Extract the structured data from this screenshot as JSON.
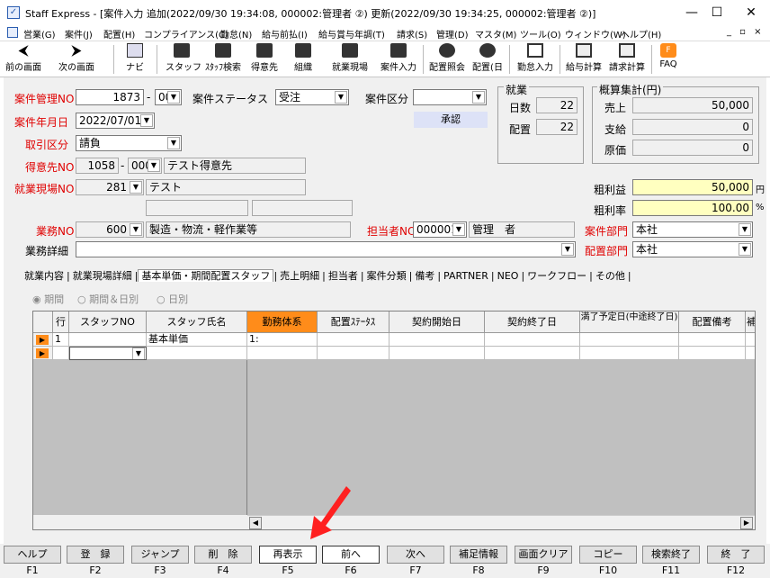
{
  "window": {
    "title": "Staff Express - [案件入力 追加(2022/09/30 19:34:08, 000002:管理者 ②) 更新(2022/09/30 19:34:25, 000002:管理者 ②)]",
    "min": "—",
    "max": "☐",
    "close": "✕"
  },
  "menu": {
    "items": [
      "営業(G)",
      "案件(J)",
      "配置(H)",
      "コンプライアンス(C)",
      "勤怠(N)",
      "給与前払(I)",
      "給与賞与年調(T)",
      "請求(S)",
      "管理(D)",
      "マスタ(M)",
      "ツール(O)",
      "ウィンドウ(W)",
      "ヘルプ(H)"
    ],
    "mdi": "_ ▫ ×"
  },
  "toolbar": {
    "items": [
      "前の画面",
      "次の画面",
      "ナビ",
      "スタッフ",
      "ｽﾀｯﾌ検索",
      "得意先",
      "組織",
      "就業現場",
      "案件入力",
      "配置照会",
      "配置(日",
      "勤怠入力",
      "給与計算",
      "請求計算",
      "FAQ"
    ]
  },
  "form": {
    "case_no_label": "案件管理NO",
    "case_no": "1873",
    "case_branch": "000",
    "status_label": "案件ステータス",
    "status": "受注",
    "category_label": "案件区分",
    "category": "",
    "approve_label": "承認",
    "date_label": "案件年月日",
    "date": "2022/07/01",
    "trade_label": "取引区分",
    "trade": "請負",
    "client_label": "得意先NO",
    "client_no": "1058",
    "client_branch": "000",
    "client_name": "テスト得意先",
    "site_label": "就業現場NO",
    "site_no": "281",
    "site_name": "テスト",
    "work_label": "業務NO",
    "work_no": "600",
    "work_name": "製造・物流・軽作業等",
    "staff_label": "担当者NO",
    "staff_no": "000001",
    "staff_name": "管理　者",
    "dept_label": "案件部門",
    "dept": "本社",
    "detail_label": "業務詳細",
    "detail": "",
    "placedept_label": "配置部門",
    "placedept": "本社",
    "dash": "-"
  },
  "shugyo": {
    "title": "就業",
    "days_label": "日数",
    "days": "22",
    "place_label": "配置",
    "place": "22"
  },
  "gaisan": {
    "title": "概算集計(円)",
    "sales_label": "売上",
    "sales": "50,000",
    "pay_label": "支給",
    "pay": "0",
    "cost_label": "原価",
    "cost": "0",
    "gross_label": "粗利益",
    "gross": "50,000",
    "gross_unit": "円",
    "rate_label": "粗利率",
    "rate": "100.00",
    "rate_unit": "%"
  },
  "tabs": [
    "就業内容",
    "就業現場詳細",
    "基本単価・期間配置スタッフ",
    "売上明細",
    "担当者",
    "案件分類",
    "備考",
    "PARTNER",
    "NEO",
    "ワークフロー",
    "その他"
  ],
  "radios": [
    "期間",
    "期間＆日別",
    "日別"
  ],
  "grid": {
    "headers": [
      "行",
      "スタッフNO",
      "スタッフ氏名",
      "勤務体系",
      "配置ｽﾃｰﾀｽ",
      "契約開始日",
      "契約終了日",
      "満了予定日(中途終了日)",
      "配置備考",
      "補"
    ],
    "row1": {
      "no": "1",
      "name": "基本単価",
      "kinmu": "1:"
    }
  },
  "fkeys": [
    {
      "label": "ヘルプ",
      "key": "F1"
    },
    {
      "label": "登　録",
      "key": "F2"
    },
    {
      "label": "ジャンプ",
      "key": "F3"
    },
    {
      "label": "削　除",
      "key": "F4"
    },
    {
      "label": "再表示",
      "key": "F5"
    },
    {
      "label": "前へ",
      "key": "F6"
    },
    {
      "label": "次へ",
      "key": "F7"
    },
    {
      "label": "補足情報",
      "key": "F8"
    },
    {
      "label": "画面クリア",
      "key": "F9"
    },
    {
      "label": "コピー",
      "key": "F10"
    },
    {
      "label": "検索終了",
      "key": "F11"
    },
    {
      "label": "終　了",
      "key": "F12"
    }
  ],
  "colors": {
    "accent": "#ff8c1a",
    "red_label": "#e00000",
    "yellow": "#ffffc0",
    "arrow": "#ff2020"
  }
}
